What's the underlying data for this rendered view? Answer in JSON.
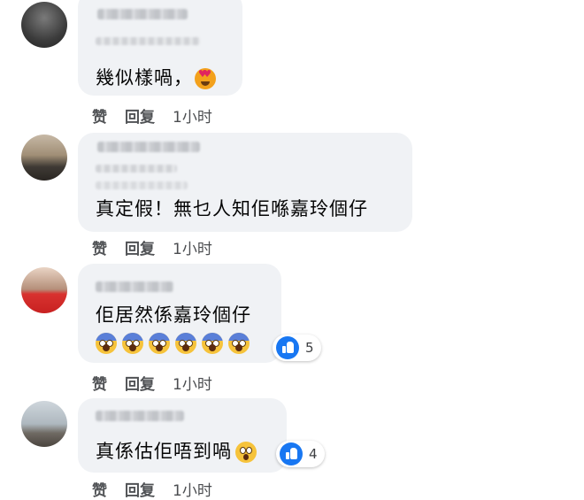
{
  "comments": [
    {
      "text": "幾似樣喎，",
      "emoji": "smiling-face-with-heart-eyes"
    },
    {
      "text": "真定假！無乜人知佢喺嘉玲個仔"
    },
    {
      "text": "佢居然係嘉玲個仔",
      "emoji_row": [
        "face-screaming-in-fear",
        "face-screaming-in-fear",
        "face-screaming-in-fear",
        "face-screaming-in-fear",
        "face-screaming-in-fear",
        "face-screaming-in-fear"
      ],
      "reaction_count": "5"
    },
    {
      "text": "真係估佢唔到喎",
      "emoji": "astonished-face",
      "reaction_count": "4"
    }
  ],
  "actions": {
    "like_label": "赞",
    "reply_label": "回复",
    "time": "1小时"
  },
  "colors": {
    "bubble": "#f0f2f5",
    "like_blue": "#1877f2",
    "action_text": "#505255"
  }
}
